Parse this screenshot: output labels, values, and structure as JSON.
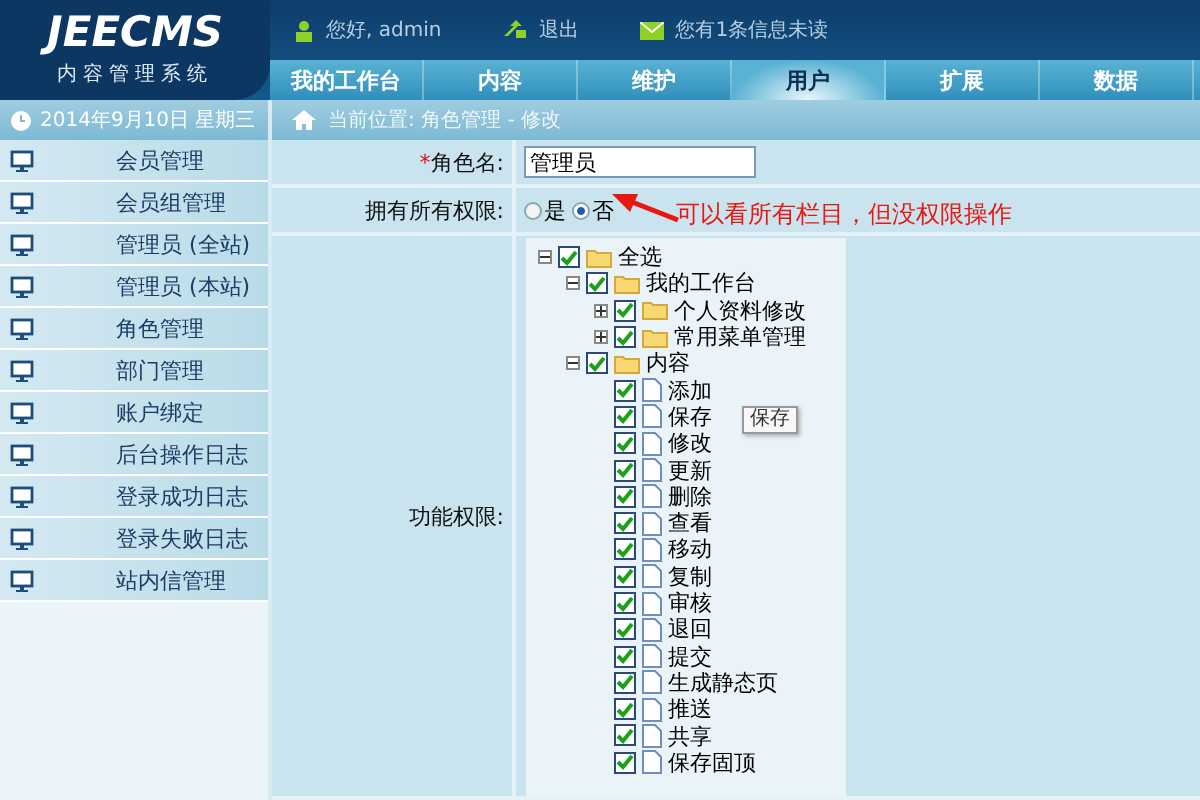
{
  "header": {
    "logo": "JEECMS",
    "subtitle": "内容管理系统",
    "greeting": "您好, admin",
    "logout": "退出",
    "messages": "您有1条信息未读"
  },
  "nav": [
    {
      "label": "我的工作台",
      "selected": false
    },
    {
      "label": "内容",
      "selected": false
    },
    {
      "label": "维护",
      "selected": false
    },
    {
      "label": "用户",
      "selected": true
    },
    {
      "label": "扩展",
      "selected": false
    },
    {
      "label": "数据",
      "selected": false
    }
  ],
  "date": "2014年9月10日 星期三",
  "breadcrumb": "当前位置: 角色管理 - 修改",
  "sidebar": {
    "items": [
      "会员管理",
      "会员组管理",
      "管理员 (全站)",
      "管理员 (本站)",
      "角色管理",
      "部门管理",
      "账户绑定",
      "后台操作日志",
      "登录成功日志",
      "登录失败日志",
      "站内信管理"
    ]
  },
  "form": {
    "name_label": "角色名:",
    "required_mark": "*",
    "name_value": "管理员",
    "all_label": "拥有所有权限:",
    "all_options": [
      {
        "label": "是",
        "selected": false
      },
      {
        "label": "否",
        "selected": true
      }
    ],
    "perm_label": "功能权限:"
  },
  "annotation": "可以看所有栏目，但没权限操作",
  "tree": [
    {
      "label": "全选",
      "checked": true,
      "expanded": true,
      "children": [
        {
          "label": "我的工作台",
          "checked": true,
          "expanded": true,
          "children": [
            {
              "label": "个人资料修改",
              "checked": true,
              "expanded": false
            },
            {
              "label": "常用菜单管理",
              "checked": true,
              "expanded": false
            }
          ]
        },
        {
          "label": "内容",
          "checked": true,
          "expanded": true,
          "children": [
            {
              "label": "添加",
              "checked": true
            },
            {
              "label": "保存",
              "checked": true,
              "tooltip": "保存"
            },
            {
              "label": "修改",
              "checked": true
            },
            {
              "label": "更新",
              "checked": true
            },
            {
              "label": "删除",
              "checked": true
            },
            {
              "label": "查看",
              "checked": true
            },
            {
              "label": "移动",
              "checked": true
            },
            {
              "label": "复制",
              "checked": true
            },
            {
              "label": "审核",
              "checked": true
            },
            {
              "label": "退回",
              "checked": true
            },
            {
              "label": "提交",
              "checked": true
            },
            {
              "label": "生成静态页",
              "checked": true
            },
            {
              "label": "推送",
              "checked": true
            },
            {
              "label": "共享",
              "checked": true
            },
            {
              "label": "保存固顶",
              "checked": true
            }
          ]
        }
      ]
    }
  ]
}
